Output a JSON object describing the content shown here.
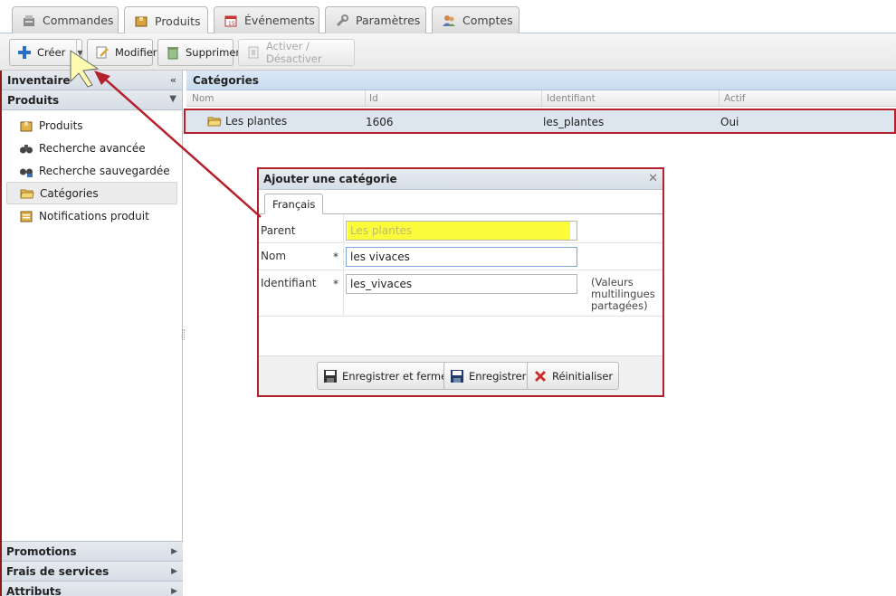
{
  "tabs": [
    {
      "label": "Commandes",
      "icon": "cash-register-icon"
    },
    {
      "label": "Produits",
      "icon": "box-icon"
    },
    {
      "label": "Événements",
      "icon": "calendar-icon"
    },
    {
      "label": "Paramètres",
      "icon": "wrench-icon"
    },
    {
      "label": "Comptes",
      "icon": "users-icon"
    }
  ],
  "toolbar": {
    "create": "Créer",
    "modify": "Modifier",
    "delete": "Supprimer",
    "toggle": "Activer / Désactiver"
  },
  "sidebar": {
    "inventory": "Inventaire",
    "products_section": "Produits",
    "items": [
      {
        "label": "Produits",
        "icon": "box-icon"
      },
      {
        "label": "Recherche avancée",
        "icon": "binoculars-icon"
      },
      {
        "label": "Recherche sauvegardée",
        "icon": "saved-search-icon"
      },
      {
        "label": "Catégories",
        "icon": "folder-icon"
      },
      {
        "label": "Notifications produit",
        "icon": "notification-icon"
      }
    ],
    "bottom": [
      "Promotions",
      "Frais de services",
      "Attributs"
    ]
  },
  "grid": {
    "title": "Catégories",
    "columns": [
      "Nom",
      "Id",
      "Identifiant",
      "Actif"
    ],
    "rows": [
      {
        "name": "Les plantes",
        "id": "1606",
        "identifier": "les_plantes",
        "active": "Oui"
      }
    ]
  },
  "dialog": {
    "title": "Ajouter une catégorie",
    "tab": "Français",
    "fields": {
      "parent_label": "Parent",
      "parent_value": "Les plantes",
      "name_label": "Nom",
      "name_value": "les vivaces",
      "identifier_label": "Identifiant",
      "identifier_value": "les_vivaces",
      "required_mark": "*",
      "note": "(Valeurs multilingues partagées)"
    },
    "buttons": {
      "save_close": "Enregistrer et fermer",
      "save": "Enregistrer",
      "reset": "Réinitialiser"
    }
  },
  "colors": {
    "highlight_border": "#b3212c",
    "parent_highlight": "#fbfb3c",
    "selected_row": "#dde6ee"
  }
}
